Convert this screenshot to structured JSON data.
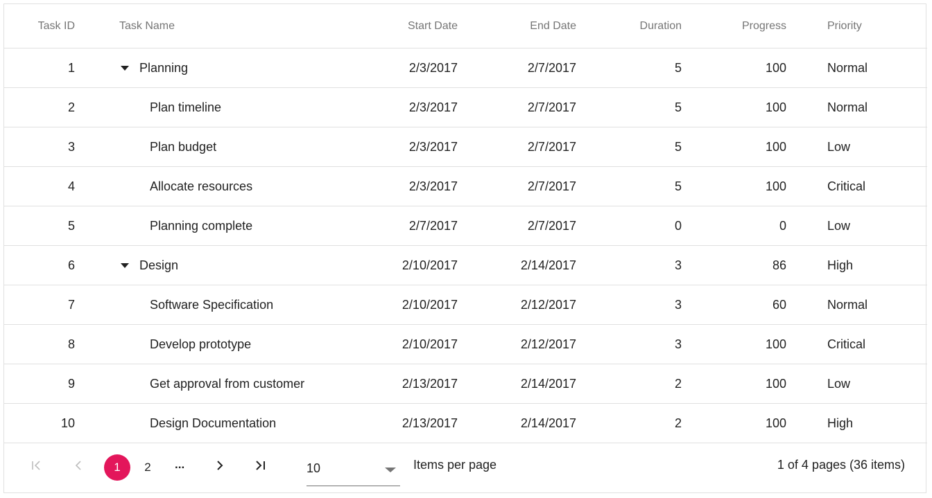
{
  "columns": {
    "task_id": "Task ID",
    "task_name": "Task Name",
    "start_date": "Start Date",
    "end_date": "End Date",
    "duration": "Duration",
    "progress": "Progress",
    "priority": "Priority"
  },
  "rows": [
    {
      "id": "1",
      "name": "Planning",
      "start": "2/3/2017",
      "end": "2/7/2017",
      "duration": "5",
      "progress": "100",
      "priority": "Normal",
      "parent": true
    },
    {
      "id": "2",
      "name": "Plan timeline",
      "start": "2/3/2017",
      "end": "2/7/2017",
      "duration": "5",
      "progress": "100",
      "priority": "Normal",
      "parent": false
    },
    {
      "id": "3",
      "name": "Plan budget",
      "start": "2/3/2017",
      "end": "2/7/2017",
      "duration": "5",
      "progress": "100",
      "priority": "Low",
      "parent": false
    },
    {
      "id": "4",
      "name": "Allocate resources",
      "start": "2/3/2017",
      "end": "2/7/2017",
      "duration": "5",
      "progress": "100",
      "priority": "Critical",
      "parent": false
    },
    {
      "id": "5",
      "name": "Planning complete",
      "start": "2/7/2017",
      "end": "2/7/2017",
      "duration": "0",
      "progress": "0",
      "priority": "Low",
      "parent": false
    },
    {
      "id": "6",
      "name": "Design",
      "start": "2/10/2017",
      "end": "2/14/2017",
      "duration": "3",
      "progress": "86",
      "priority": "High",
      "parent": true
    },
    {
      "id": "7",
      "name": "Software Specification",
      "start": "2/10/2017",
      "end": "2/12/2017",
      "duration": "3",
      "progress": "60",
      "priority": "Normal",
      "parent": false
    },
    {
      "id": "8",
      "name": "Develop prototype",
      "start": "2/10/2017",
      "end": "2/12/2017",
      "duration": "3",
      "progress": "100",
      "priority": "Critical",
      "parent": false
    },
    {
      "id": "9",
      "name": "Get approval from customer",
      "start": "2/13/2017",
      "end": "2/14/2017",
      "duration": "2",
      "progress": "100",
      "priority": "Low",
      "parent": false
    },
    {
      "id": "10",
      "name": "Design Documentation",
      "start": "2/13/2017",
      "end": "2/14/2017",
      "duration": "2",
      "progress": "100",
      "priority": "High",
      "parent": false
    }
  ],
  "pager": {
    "first_icon": "first-page-icon",
    "prev_icon": "previous-page-icon",
    "next_icon": "next-page-icon",
    "last_icon": "last-page-icon",
    "pages": [
      "1",
      "2"
    ],
    "active_page": "1",
    "ellipsis": "...",
    "page_size": "10",
    "items_per_page_label": "Items per page",
    "info": "1 of 4 pages (36 items)"
  },
  "colors": {
    "accent": "#e3165b",
    "border": "#e0e0e0",
    "header_text": "#757575",
    "body_text": "#212121"
  }
}
